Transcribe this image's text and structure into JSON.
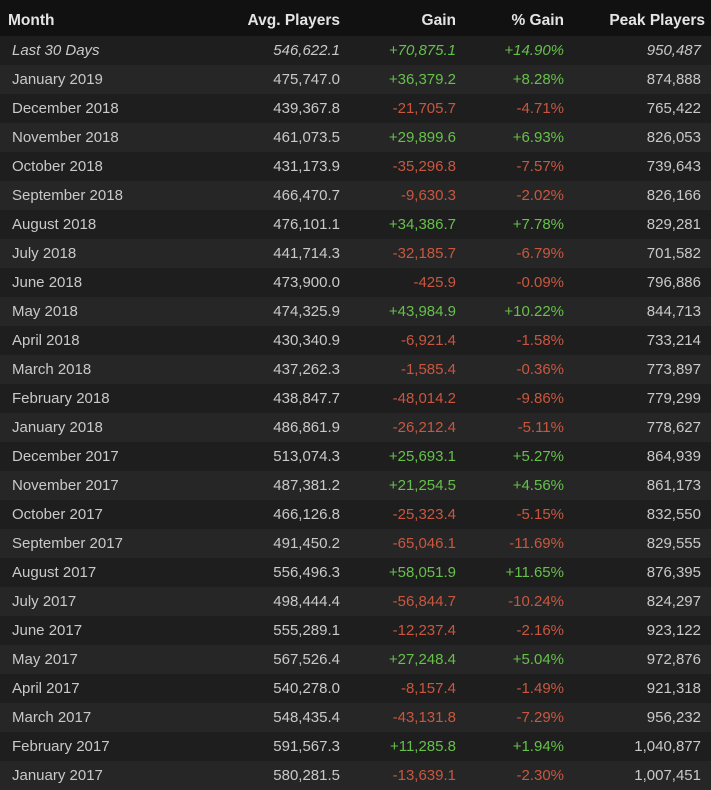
{
  "columns": {
    "month": "Month",
    "avg_players": "Avg. Players",
    "gain": "Gain",
    "pct_gain": "% Gain",
    "peak_players": "Peak Players"
  },
  "colors": {
    "positive": "#66c04a",
    "negative": "#c9573f",
    "background": "#1b1b1b"
  },
  "rows": [
    {
      "month": "Last 30 Days",
      "avg": "546,622.1",
      "gain": "+70,875.1",
      "pct": "+14.90%",
      "peak": "950,487",
      "trend": "pos",
      "italic": true
    },
    {
      "month": "January 2019",
      "avg": "475,747.0",
      "gain": "+36,379.2",
      "pct": "+8.28%",
      "peak": "874,888",
      "trend": "pos"
    },
    {
      "month": "December 2018",
      "avg": "439,367.8",
      "gain": "-21,705.7",
      "pct": "-4.71%",
      "peak": "765,422",
      "trend": "neg"
    },
    {
      "month": "November 2018",
      "avg": "461,073.5",
      "gain": "+29,899.6",
      "pct": "+6.93%",
      "peak": "826,053",
      "trend": "pos"
    },
    {
      "month": "October 2018",
      "avg": "431,173.9",
      "gain": "-35,296.8",
      "pct": "-7.57%",
      "peak": "739,643",
      "trend": "neg"
    },
    {
      "month": "September 2018",
      "avg": "466,470.7",
      "gain": "-9,630.3",
      "pct": "-2.02%",
      "peak": "826,166",
      "trend": "neg"
    },
    {
      "month": "August 2018",
      "avg": "476,101.1",
      "gain": "+34,386.7",
      "pct": "+7.78%",
      "peak": "829,281",
      "trend": "pos"
    },
    {
      "month": "July 2018",
      "avg": "441,714.3",
      "gain": "-32,185.7",
      "pct": "-6.79%",
      "peak": "701,582",
      "trend": "neg"
    },
    {
      "month": "June 2018",
      "avg": "473,900.0",
      "gain": "-425.9",
      "pct": "-0.09%",
      "peak": "796,886",
      "trend": "neg"
    },
    {
      "month": "May 2018",
      "avg": "474,325.9",
      "gain": "+43,984.9",
      "pct": "+10.22%",
      "peak": "844,713",
      "trend": "pos"
    },
    {
      "month": "April 2018",
      "avg": "430,340.9",
      "gain": "-6,921.4",
      "pct": "-1.58%",
      "peak": "733,214",
      "trend": "neg"
    },
    {
      "month": "March 2018",
      "avg": "437,262.3",
      "gain": "-1,585.4",
      "pct": "-0.36%",
      "peak": "773,897",
      "trend": "neg"
    },
    {
      "month": "February 2018",
      "avg": "438,847.7",
      "gain": "-48,014.2",
      "pct": "-9.86%",
      "peak": "779,299",
      "trend": "neg"
    },
    {
      "month": "January 2018",
      "avg": "486,861.9",
      "gain": "-26,212.4",
      "pct": "-5.11%",
      "peak": "778,627",
      "trend": "neg"
    },
    {
      "month": "December 2017",
      "avg": "513,074.3",
      "gain": "+25,693.1",
      "pct": "+5.27%",
      "peak": "864,939",
      "trend": "pos"
    },
    {
      "month": "November 2017",
      "avg": "487,381.2",
      "gain": "+21,254.5",
      "pct": "+4.56%",
      "peak": "861,173",
      "trend": "pos"
    },
    {
      "month": "October 2017",
      "avg": "466,126.8",
      "gain": "-25,323.4",
      "pct": "-5.15%",
      "peak": "832,550",
      "trend": "neg"
    },
    {
      "month": "September 2017",
      "avg": "491,450.2",
      "gain": "-65,046.1",
      "pct": "-11.69%",
      "peak": "829,555",
      "trend": "neg"
    },
    {
      "month": "August 2017",
      "avg": "556,496.3",
      "gain": "+58,051.9",
      "pct": "+11.65%",
      "peak": "876,395",
      "trend": "pos"
    },
    {
      "month": "July 2017",
      "avg": "498,444.4",
      "gain": "-56,844.7",
      "pct": "-10.24%",
      "peak": "824,297",
      "trend": "neg"
    },
    {
      "month": "June 2017",
      "avg": "555,289.1",
      "gain": "-12,237.4",
      "pct": "-2.16%",
      "peak": "923,122",
      "trend": "neg"
    },
    {
      "month": "May 2017",
      "avg": "567,526.4",
      "gain": "+27,248.4",
      "pct": "+5.04%",
      "peak": "972,876",
      "trend": "pos"
    },
    {
      "month": "April 2017",
      "avg": "540,278.0",
      "gain": "-8,157.4",
      "pct": "-1.49%",
      "peak": "921,318",
      "trend": "neg"
    },
    {
      "month": "March 2017",
      "avg": "548,435.4",
      "gain": "-43,131.8",
      "pct": "-7.29%",
      "peak": "956,232",
      "trend": "neg"
    },
    {
      "month": "February 2017",
      "avg": "591,567.3",
      "gain": "+11,285.8",
      "pct": "+1.94%",
      "peak": "1,040,877",
      "trend": "pos"
    },
    {
      "month": "January 2017",
      "avg": "580,281.5",
      "gain": "-13,639.1",
      "pct": "-2.30%",
      "peak": "1,007,451",
      "trend": "neg"
    }
  ]
}
